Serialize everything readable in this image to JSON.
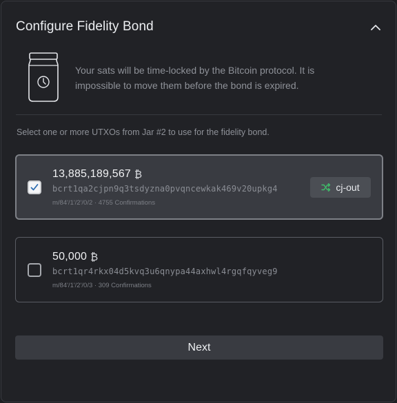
{
  "header": {
    "title": "Configure Fidelity Bond"
  },
  "info": {
    "text": "Your sats will be time-locked by the Bitcoin protocol. It is impossible to move them before the bond is expired."
  },
  "instruction": "Select one or more UTXOs from Jar #2 to use for the fidelity bond.",
  "utxos": [
    {
      "amount": "13,885,189,567",
      "unit_symbol": "₿",
      "address": "bcrt1qa2cjpn9q3tsdyzna0pvqncewkak469v20upkg4",
      "meta": "m/84'/1'/2'/0/2 · 4755 Confirmations",
      "selected": true,
      "tag": "cj-out"
    },
    {
      "amount": "50,000",
      "unit_symbol": "₿",
      "address": "bcrt1qr4rkx04d5kvq3u6qnypa44axhwl4rgqfqyveg9",
      "meta": "m/84'/1'/2'/0/3 · 309 Confirmations",
      "selected": false
    }
  ],
  "actions": {
    "next_label": "Next"
  },
  "colors": {
    "tag_icon": "#3fbf6a",
    "check": "#2b6cb0"
  }
}
